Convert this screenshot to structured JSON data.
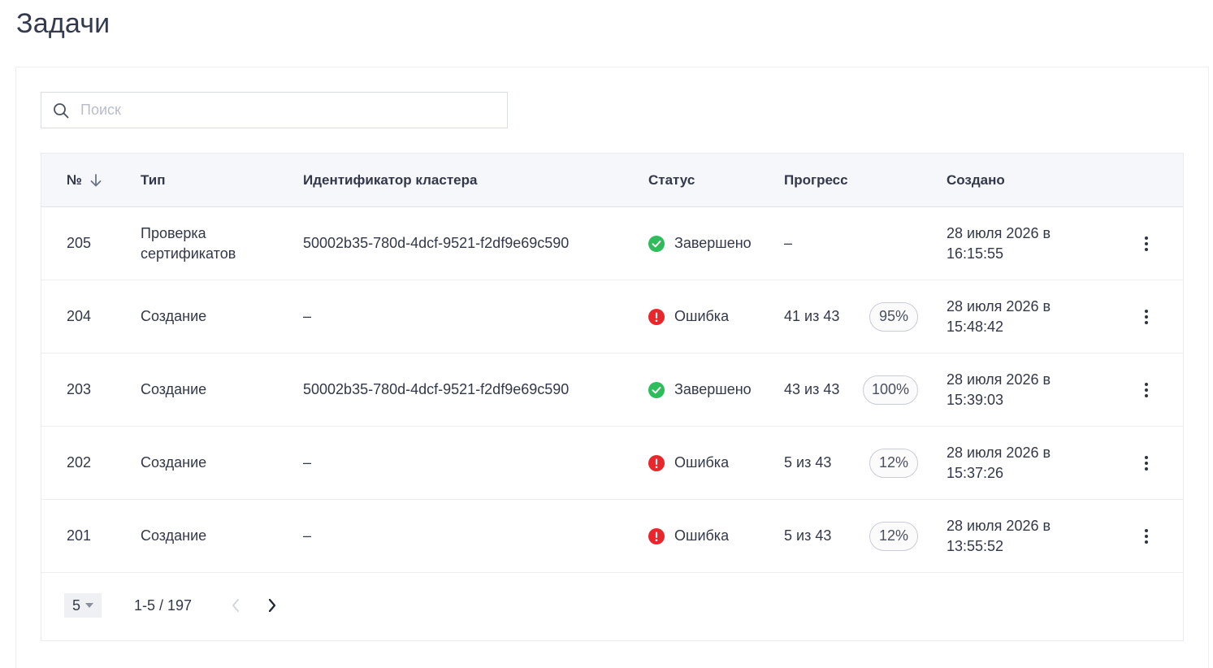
{
  "page": {
    "title": "Задачи"
  },
  "search": {
    "placeholder": "Поиск",
    "value": ""
  },
  "table": {
    "columns": {
      "num": "№",
      "type": "Тип",
      "cluster": "Идентификатор кластера",
      "status": "Статус",
      "progress": "Прогресс",
      "created": "Создано"
    },
    "rows": [
      {
        "num": "205",
        "type": "Проверка сертификатов",
        "cluster": "50002b35-780d-4dcf-9521-f2df9e69c590",
        "status": "Завершено",
        "status_kind": "success",
        "progress_text": "–",
        "progress_pct": "",
        "created": "28 июля 2026 в 16:15:55"
      },
      {
        "num": "204",
        "type": "Создание",
        "cluster": "–",
        "status": "Ошибка",
        "status_kind": "error",
        "progress_text": "41 из 43",
        "progress_pct": "95%",
        "created": "28 июля 2026 в 15:48:42"
      },
      {
        "num": "203",
        "type": "Создание",
        "cluster": "50002b35-780d-4dcf-9521-f2df9e69c590",
        "status": "Завершено",
        "status_kind": "success",
        "progress_text": "43 из 43",
        "progress_pct": "100%",
        "created": "28 июля 2026 в 15:39:03"
      },
      {
        "num": "202",
        "type": "Создание",
        "cluster": "–",
        "status": "Ошибка",
        "status_kind": "error",
        "progress_text": "5 из 43",
        "progress_pct": "12%",
        "created": "28 июля 2026 в 15:37:26"
      },
      {
        "num": "201",
        "type": "Создание",
        "cluster": "–",
        "status": "Ошибка",
        "status_kind": "error",
        "progress_text": "5 из 43",
        "progress_pct": "12%",
        "created": "28 июля 2026 в 13:55:52"
      }
    ]
  },
  "pagination": {
    "page_size": "5",
    "range": "1-5 / 197"
  },
  "colors": {
    "success": "#2dbd5b",
    "error": "#e8262c",
    "accent": "#343a4d"
  },
  "icons": {
    "sort": "arrow-down-icon",
    "search": "search-icon",
    "success": "check-circle-icon",
    "error": "exclamation-circle-icon",
    "menu": "more-vertical-icon",
    "prev": "chevron-left-icon",
    "next": "chevron-right-icon",
    "caret": "caret-down-icon"
  }
}
